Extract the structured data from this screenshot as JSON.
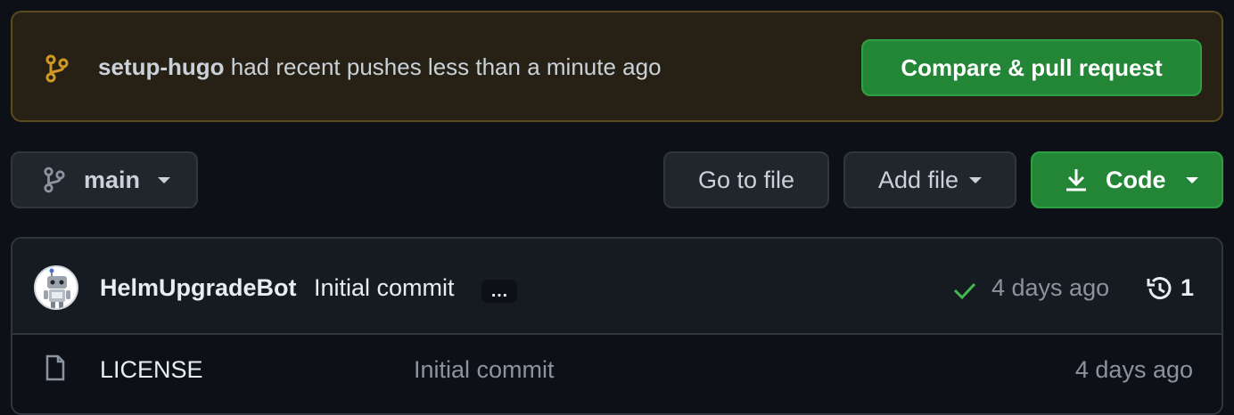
{
  "banner": {
    "branch_name": "setup-hugo",
    "message": "had recent pushes less than a minute ago",
    "compare_button": "Compare & pull request",
    "icon": "git-branch-icon",
    "accent_color": "#d29922"
  },
  "toolbar": {
    "branch_label": "main",
    "go_to_file": "Go to file",
    "add_file": "Add file",
    "code": "Code"
  },
  "latest_commit": {
    "author": "HelmUpgradeBot",
    "message": "Initial commit",
    "ellipsis": "…",
    "status": "success",
    "time": "4 days ago",
    "history_count": "1"
  },
  "files": [
    {
      "name": "LICENSE",
      "commit_message": "Initial commit",
      "time": "4 days ago",
      "icon": "file-icon"
    }
  ],
  "colors": {
    "primary_green": "#238636",
    "check_green": "#3fb950",
    "muted_text": "#8b949e"
  }
}
